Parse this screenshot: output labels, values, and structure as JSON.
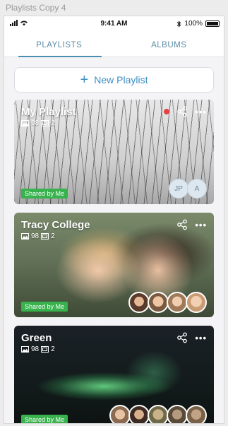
{
  "window_title": "Playlists Copy 4",
  "status_bar": {
    "time": "9:41 AM",
    "battery": "100%"
  },
  "tabs": [
    {
      "label": "PLAYLISTS",
      "active": true
    },
    {
      "label": "ALBUMS",
      "active": false
    }
  ],
  "new_playlist_label": "New Playlist",
  "playlists": [
    {
      "title": "My Playlist",
      "photo_count": "98",
      "video_count": "2",
      "shared_label": "Shared by Me",
      "collaborators": [
        "JP",
        "A"
      ],
      "has_unread_dot": true
    },
    {
      "title": "Tracy College",
      "photo_count": "98",
      "video_count": "2",
      "shared_label": "Shared by Me",
      "avatar_count": 4
    },
    {
      "title": "Green",
      "photo_count": "98",
      "video_count": "2",
      "shared_label": "Shared by Me",
      "avatar_count": 5
    }
  ],
  "colors": {
    "accent": "#3c8fc4",
    "shared_badge": "#37b24d",
    "unread_dot": "#e5413f"
  },
  "icons": [
    "signal-icon",
    "wifi-icon",
    "bluetooth-icon",
    "battery-icon",
    "plus-icon",
    "photo-icon",
    "video-icon",
    "share-icon",
    "more-icon"
  ]
}
